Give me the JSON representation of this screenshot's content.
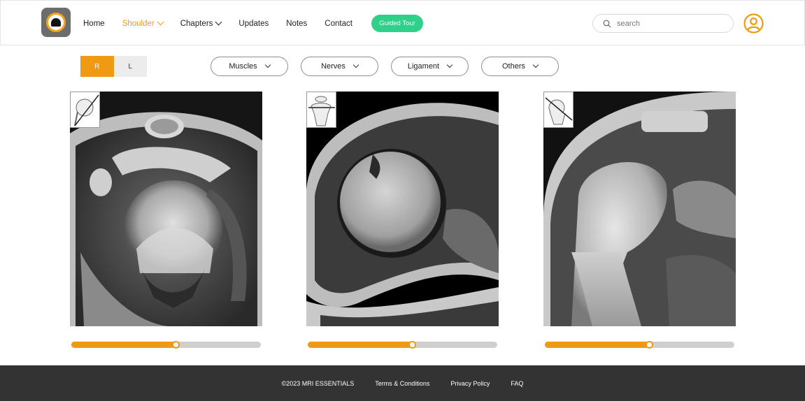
{
  "header": {
    "logo_icon": "mri-scanner-logo-icon",
    "nav": [
      {
        "label": "Home",
        "dropdown": false,
        "active": false
      },
      {
        "label": "Shoulder",
        "dropdown": true,
        "active": true
      },
      {
        "label": "Chapters",
        "dropdown": true,
        "active": false
      },
      {
        "label": "Updates",
        "dropdown": false,
        "active": false
      },
      {
        "label": "Notes",
        "dropdown": false,
        "active": false
      },
      {
        "label": "Contact",
        "dropdown": false,
        "active": false
      }
    ],
    "guided_tour_label": "Guided Tour",
    "search_placeholder": "search",
    "search_icon": "search-icon",
    "user_icon": "user-circle-icon"
  },
  "side_toggle": {
    "options": [
      "R",
      "L"
    ],
    "selected": "R"
  },
  "filters": [
    {
      "label": "Muscles"
    },
    {
      "label": "Nerves"
    },
    {
      "label": "Ligament"
    },
    {
      "label": "Others"
    }
  ],
  "panels": [
    {
      "plane": "axial",
      "thumb_icon": "axial-plane-orientation-icon",
      "slider_value": 0.55
    },
    {
      "plane": "sagittal",
      "thumb_icon": "sagittal-plane-orientation-icon",
      "slider_value": 0.55
    },
    {
      "plane": "coronal",
      "thumb_icon": "coronal-plane-orientation-icon",
      "slider_value": 0.55
    }
  ],
  "colors": {
    "accent": "#ef9a12",
    "active_nav": "#ec9a1c",
    "guided_tour": "#2ed08a",
    "footer_bg": "#333333"
  },
  "footer": {
    "copyright": "©2023 MRI ESSENTIALS",
    "links": [
      "Terms & Conditions",
      "Privacy Policy",
      "FAQ"
    ]
  }
}
